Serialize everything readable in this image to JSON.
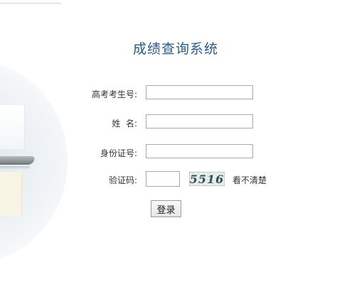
{
  "page": {
    "title": "成绩查询系统"
  },
  "form": {
    "exam_no_label": "高考考生号:",
    "exam_no_value": "",
    "name_label": "姓  名:",
    "name_value": "",
    "id_label": "身份证号:",
    "id_value": "",
    "captcha_label": "验证码:",
    "captcha_value": "",
    "captcha_text": "5516",
    "refresh_label": "看不清楚",
    "submit_label": "登录"
  }
}
